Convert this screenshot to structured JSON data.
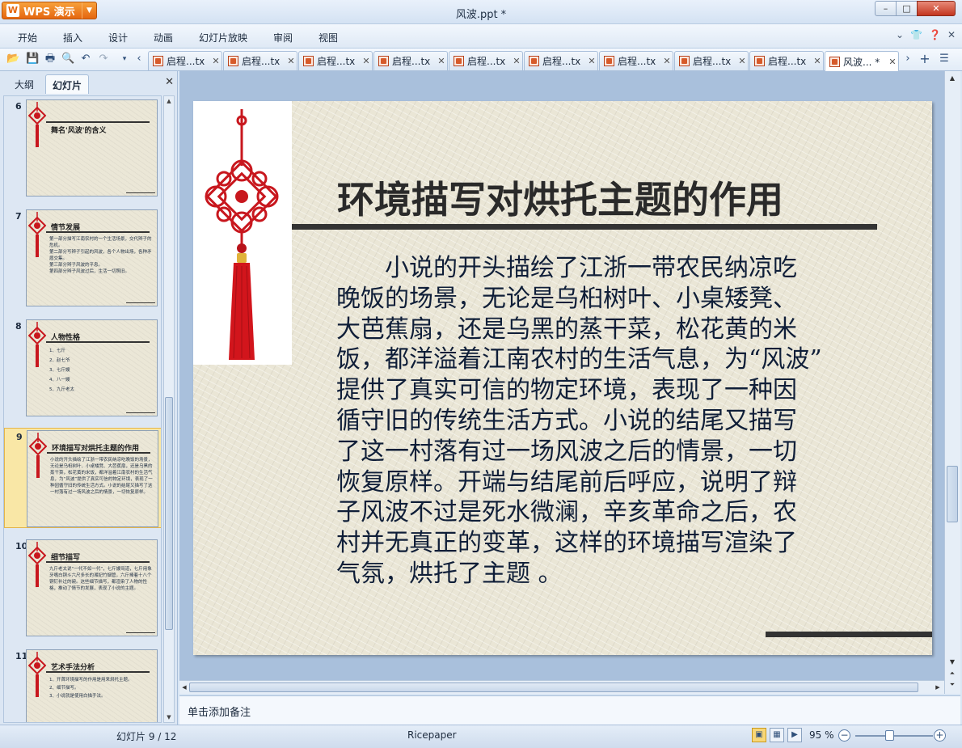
{
  "titlebar": {
    "app_button": "WPS 演示",
    "document_title": "风波.ppt *",
    "minimize": "–",
    "maximize": "□",
    "close": "✕"
  },
  "menu": {
    "items": [
      "开始",
      "插入",
      "设计",
      "动画",
      "幻灯片放映",
      "审阅",
      "视图"
    ]
  },
  "tabs": [
    {
      "label": "启程...tx"
    },
    {
      "label": "启程...tx"
    },
    {
      "label": "启程...tx"
    },
    {
      "label": "启程...tx"
    },
    {
      "label": "启程...tx"
    },
    {
      "label": "启程...tx"
    },
    {
      "label": "启程...tx"
    },
    {
      "label": "启程...tx"
    },
    {
      "label": "启程...tx"
    },
    {
      "label": "风波... *",
      "active": true
    }
  ],
  "sidepanel": {
    "tab_outline": "大纲",
    "tab_slides": "幻灯片",
    "close": "✕",
    "slides": [
      {
        "number": "6",
        "title": "舞名'风波'的含义",
        "lines": []
      },
      {
        "number": "7",
        "title": "情节发展",
        "lines": [
          "第一部分描写江南农村的一个生活场景，交代辫子的危机。",
          "第二部分写辫子引起的风波，各个人物出场，各种矛盾交集。",
          "第三部分辫子风波的平息。",
          "第四部分辫子风波过后，生活一切照旧。"
        ]
      },
      {
        "number": "8",
        "title": "人物性格",
        "lines": [
          "1、七斤",
          "2、赵七爷",
          "3、七斤嫂",
          "4、八一嫂",
          "5、九斤老太"
        ]
      },
      {
        "number": "9",
        "title": "环境描写对烘托主题的作用",
        "selected": true,
        "lines": [
          "小说的开头描绘了江浙一带农民纳凉吃晚饭的场景，无论是乌桕树叶、小桌矮凳、大芭蕉扇，还是乌黑的蒸干菜，松花黄的米饭，都洋溢着江南农村的生活气息，为“风波”提供了真实可信的物定环境，表现了一种因循守旧的传统生活方式。小说的结尾又描写了这一村落有过一场风波之后的情景，一切恢复原样。"
        ]
      },
      {
        "number": "10",
        "title": "细节描写",
        "lines": [
          "九斤老太说“一代不如一代”，七斤嫂骂道，七斤用象牙嘴白铜斗六尺多长的湘妃竹烟管，六斤捧着十八个铜钉补过的碗。这些细节描写，都渲染了人物的性格，推动了情节的发展，表现了小说的主题。"
        ]
      },
      {
        "number": "11",
        "title": "艺术手法分析",
        "lines": [
          "1、开首环境描写的作用是用来烘托主题。",
          "2、细节描写。",
          "3、小说就是使用白描手法。"
        ]
      }
    ]
  },
  "slide": {
    "title": "环境描写对烘托主题的作用",
    "body_lines": [
      "　　小说的开头描绘了江浙一带农民纳凉吃",
      "晚饭的场景，无论是乌桕树叶、小桌矮凳、",
      "大芭蕉扇，还是乌黑的蒸干菜，松花黄的米",
      "饭，都洋溢着江南农村的生活气息，为“风波”",
      "提供了真实可信的物定环境，表现了一种因",
      "循守旧的传统生活方式。小说的结尾又描写",
      "了这一村落有过一场风波之后的情景，一切",
      "恢复原样。开端与结尾前后呼应，说明了辩",
      "子风波不过是死水微澜，辛亥革命之后，农",
      "村并无真正的变革，这样的环境描写渲染了",
      "气氛，烘托了主题 。"
    ]
  },
  "notes": {
    "placeholder": "单击添加备注"
  },
  "status": {
    "slide_indicator": "幻灯片 9 / 12",
    "theme": "Ricepaper",
    "zoom": "95 %"
  },
  "colors": {
    "knot_red": "#c8171e",
    "title_rule": "#333333",
    "accent_orange": "#e5660f"
  }
}
